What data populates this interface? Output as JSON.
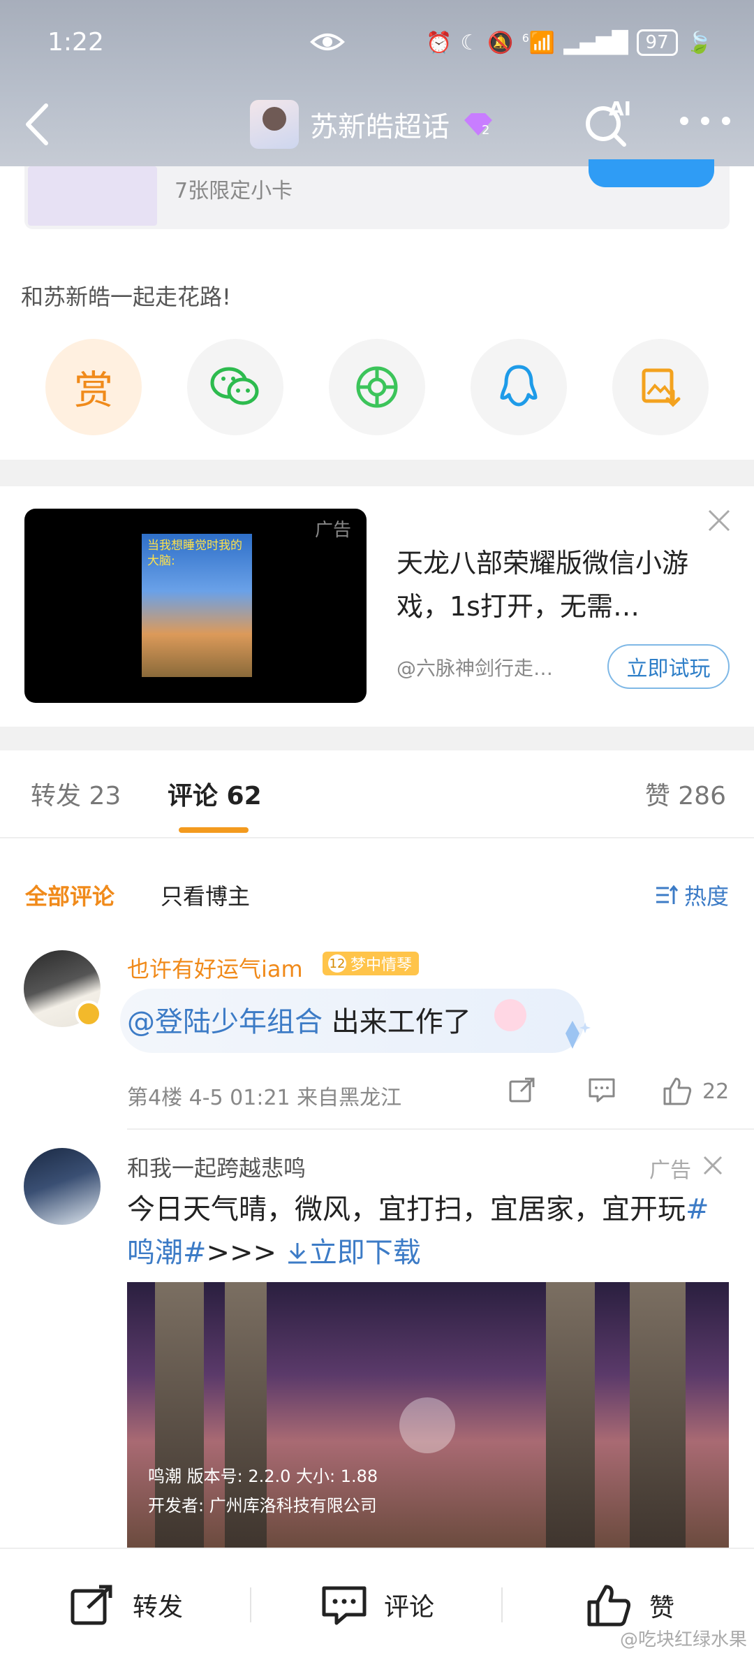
{
  "status": {
    "time": "1:22",
    "signal_sub": "6",
    "battery": "97"
  },
  "nav": {
    "title": "苏新皓超话"
  },
  "card": {
    "prize_text": "7张限定小卡",
    "slogan": "和苏新皓一起走花路!",
    "reward_label": "赏"
  },
  "ad": {
    "label": "广告",
    "video_caption": "当我想睡觉时我的大脑:",
    "title": "天龙八部荣耀版微信小游戏，1s打开，无需…",
    "source": "@六脉神剑行走…",
    "cta": "立即试玩"
  },
  "tabs": {
    "repost": "转发 23",
    "comment": "评论 62",
    "like": "赞 286"
  },
  "filter": {
    "all": "全部评论",
    "host": "只看博主",
    "sort": "热度"
  },
  "comments": [
    {
      "name": "也许有好运气iam",
      "level": "12",
      "badge": "梦中情琴",
      "mention": "@登陆少年组合",
      "text": " 出来工作了",
      "meta": "第4楼 4-5 01:21 来自黑龙江",
      "likes": "22"
    },
    {
      "name": "和我一起跨越悲鸣",
      "ad_label": "广告",
      "text": "今日天气晴，微风，宜打扫，宜居家，宜开玩",
      "topic": "#鸣潮#",
      "arrows": ">>>",
      "download": "立即下载",
      "img_caption1": "鸣潮  版本号: 2.2.0  大小: 1.88",
      "img_caption2": "开发者: 广州库洛科技有限公司"
    }
  ],
  "bottom": {
    "repost": "转发",
    "comment": "评论",
    "like": "赞"
  },
  "watermark": "@吃块红绿水果",
  "colors": {
    "accent": "#f08a1a",
    "link": "#3c7bc6",
    "cta_blue": "#2f9cf5"
  }
}
